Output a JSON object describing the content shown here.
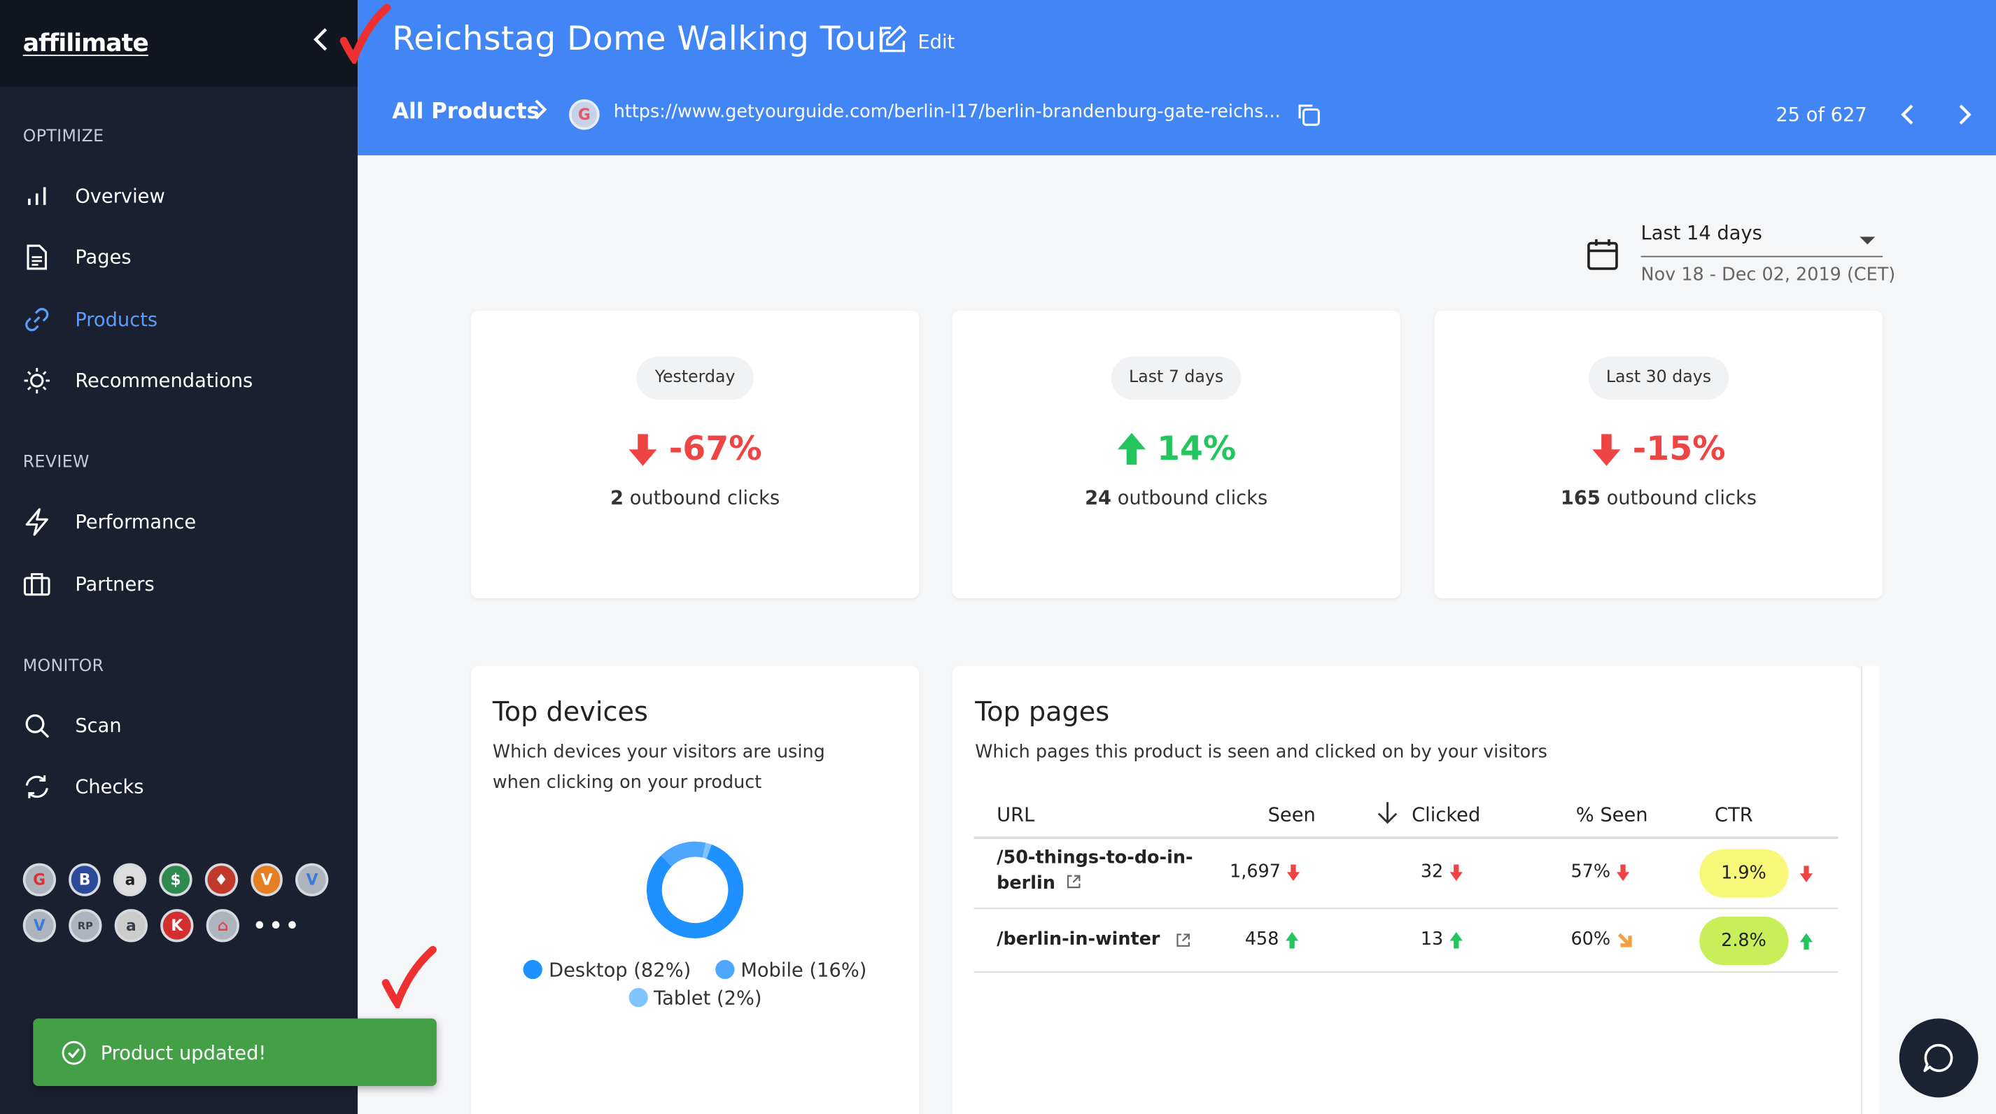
{
  "sidebar": {
    "logo": "affilimate",
    "sections": {
      "optimize": "OPTIMIZE",
      "review": "REVIEW",
      "monitor": "MONITOR"
    },
    "items": [
      {
        "label": "Overview",
        "icon": "bar-chart-icon"
      },
      {
        "label": "Pages",
        "icon": "document-icon"
      },
      {
        "label": "Products",
        "icon": "link-icon",
        "active": true
      },
      {
        "label": "Recommendations",
        "icon": "sun-icon"
      },
      {
        "label": "Performance",
        "icon": "lightning-icon"
      },
      {
        "label": "Partners",
        "icon": "briefcase-icon"
      },
      {
        "label": "Scan",
        "icon": "search-icon"
      },
      {
        "label": "Checks",
        "icon": "refresh-icon"
      }
    ],
    "partner_logos": [
      "G",
      "B",
      "a",
      "$",
      "♦",
      "V",
      "V",
      "V",
      "RP",
      "a",
      "K",
      "⌂"
    ],
    "more": "•••"
  },
  "toast": {
    "message": "Product updated!"
  },
  "header": {
    "title": "Reichstag Dome Walking Tour",
    "edit_label": "Edit",
    "breadcrumb": "All Products",
    "favicon_letter": "G",
    "url": "https://www.getyourguide.com/berlin-l17/berlin-brandenburg-gate-reichs...",
    "pager": "25 of 627"
  },
  "date_filter": {
    "selected": "Last 14 days",
    "range": "Nov 18 - Dec 02, 2019 (CET)"
  },
  "stats": [
    {
      "period": "Yesterday",
      "change": "-67%",
      "direction": "down",
      "clicks": "2",
      "clicks_label": "outbound clicks"
    },
    {
      "period": "Last 7 days",
      "change": "14%",
      "direction": "up",
      "clicks": "24",
      "clicks_label": "outbound clicks"
    },
    {
      "period": "Last 30 days",
      "change": "-15%",
      "direction": "down",
      "clicks": "165",
      "clicks_label": "outbound clicks"
    }
  ],
  "devices": {
    "title": "Top devices",
    "subtitle": "Which devices your visitors are using when clicking on your product",
    "segments": [
      {
        "label": "Desktop (82%)",
        "value": 82,
        "color": "#1e90ff"
      },
      {
        "label": "Mobile (16%)",
        "value": 16,
        "color": "#4da6ff"
      },
      {
        "label": "Tablet (2%)",
        "value": 2,
        "color": "#80c4ff"
      }
    ]
  },
  "pages": {
    "title": "Top pages",
    "subtitle": "Which pages this product is seen and clicked on by your visitors",
    "columns": {
      "url": "URL",
      "seen": "Seen",
      "clicked": "Clicked",
      "pct_seen": "% Seen",
      "ctr": "CTR"
    },
    "rows": [
      {
        "url_line1": "/50-things-to-do-in-",
        "url_line2": "berlin",
        "seen": "1,697",
        "seen_dir": "down",
        "clicked": "32",
        "clicked_dir": "down",
        "pct_seen": "57%",
        "pct_dir": "down",
        "ctr": "1.9%",
        "ctr_dir": "down",
        "ctr_color": "#f7f77a"
      },
      {
        "url_line1": "/berlin-in-winter",
        "url_line2": "",
        "seen": "458",
        "seen_dir": "up",
        "clicked": "13",
        "clicked_dir": "up",
        "pct_seen": "60%",
        "pct_dir": "down-right",
        "ctr": "2.8%",
        "ctr_dir": "up",
        "ctr_color": "#c6ef5a"
      }
    ]
  },
  "colors": {
    "accent": "#4285f4",
    "sidebar": "#1a2030",
    "down": "#ef4444",
    "up": "#22c55e",
    "toast": "#43a047"
  }
}
